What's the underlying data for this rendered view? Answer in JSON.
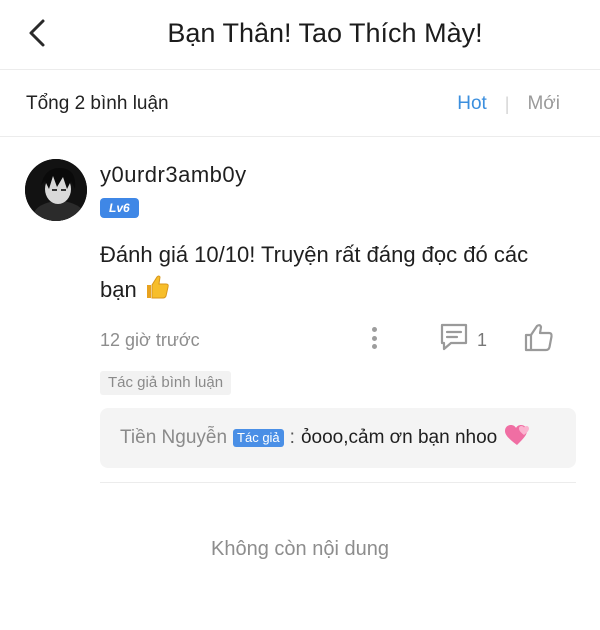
{
  "header": {
    "title": "Bạn Thân! Tao Thích Mày!",
    "back_icon": "chevron-left-icon"
  },
  "comments_bar": {
    "total_label": "Tổng 2 bình luận",
    "sort_hot": "Hot",
    "sort_new": "Mới",
    "active_sort_color": "#3b8fde"
  },
  "comment": {
    "username": "y0urdr3amb0y",
    "level": "Lv6",
    "body": "Đánh giá 10/10! Truyện rất đáng đọc đó các bạn",
    "emoji_icon": "thumbs-up-emoji",
    "time": "12 giờ trước",
    "reply_count": "1",
    "author_tag": "Tác giả bình luận",
    "level_color": "#3f87e6"
  },
  "reply": {
    "name": "Tiền Nguyễn",
    "badge": "Tác giả",
    "separator": ":",
    "text": "ỏooo,cảm ơn bạn nhoo",
    "emoji_icon": "two-hearts-emoji"
  },
  "footer": {
    "end_message": "Không còn nội dung"
  }
}
